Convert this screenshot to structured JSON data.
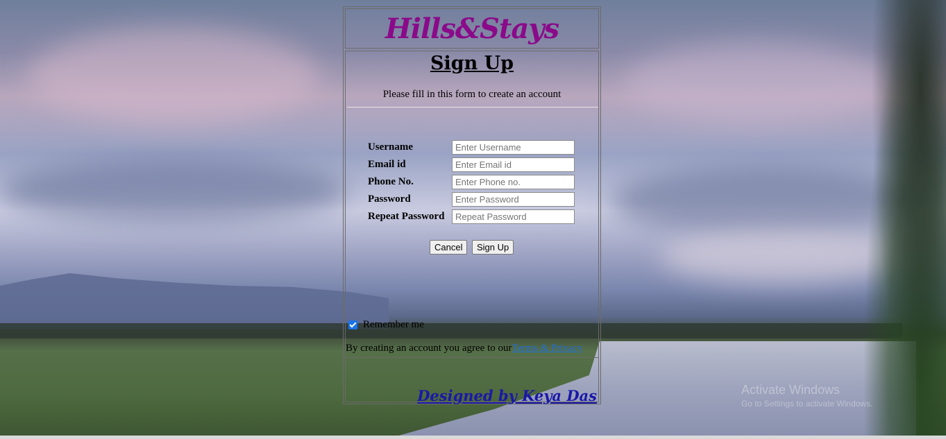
{
  "brand": "Hills&Stays",
  "form": {
    "title": "Sign Up",
    "subtitle": "Please fill in this form to create an account",
    "fields": [
      {
        "label": "Username",
        "placeholder": "Enter Username"
      },
      {
        "label": "Email id",
        "placeholder": "Enter Email id"
      },
      {
        "label": "Phone No.",
        "placeholder": "Enter Phone no."
      },
      {
        "label": "Password",
        "placeholder": "Enter Password"
      },
      {
        "label": "Repeat Password",
        "placeholder": "Repeat Password"
      }
    ],
    "cancel_label": "Cancel",
    "signup_label": "Sign Up",
    "remember_label": "Remember me",
    "remember_checked": true,
    "terms_text": "By creating an account you agree to our",
    "terms_link": "Terms & Privacy"
  },
  "footer": {
    "designer": "Designed by Keya Das"
  },
  "watermark": {
    "title": "Activate Windows",
    "subtitle": "Go to Settings to activate Windows."
  },
  "colors": {
    "brand": "#8a0a8a",
    "link": "#1e6fd9",
    "designer": "#1a18a8"
  }
}
